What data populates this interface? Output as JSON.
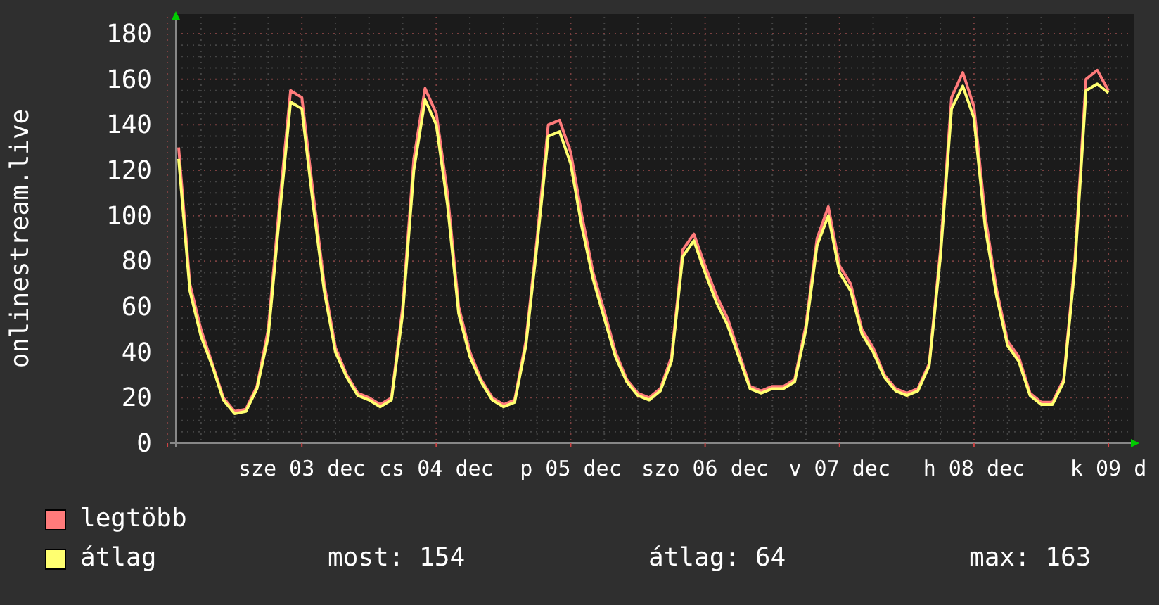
{
  "chart_data": {
    "type": "line",
    "ylabel": "onlinestream.live",
    "categories": [
      null,
      null,
      null,
      null,
      null,
      null,
      null,
      null,
      null,
      null,
      null,
      "sze 03 dec",
      null,
      null,
      null,
      null,
      null,
      null,
      null,
      null,
      null,
      null,
      null,
      "cs 04 dec",
      null,
      null,
      null,
      null,
      null,
      null,
      null,
      null,
      null,
      null,
      null,
      "p 05 dec",
      null,
      null,
      null,
      null,
      null,
      null,
      null,
      null,
      null,
      null,
      null,
      "szo 06 dec",
      null,
      null,
      null,
      null,
      null,
      null,
      null,
      null,
      null,
      null,
      null,
      "v 07 dec",
      null,
      null,
      null,
      null,
      null,
      null,
      null,
      null,
      null,
      null,
      null,
      "h 08 dec",
      null,
      null,
      null,
      null,
      null,
      null,
      null,
      null,
      null,
      null,
      null,
      "k 09 d"
    ],
    "series": [
      {
        "name": "legtöbb",
        "color": "#ff7b7b",
        "values": [
          130,
          70,
          50,
          35,
          20,
          14,
          15,
          25,
          50,
          105,
          155,
          152,
          110,
          70,
          42,
          30,
          22,
          20,
          17,
          20,
          60,
          125,
          156,
          145,
          110,
          60,
          40,
          28,
          20,
          17,
          19,
          45,
          90,
          140,
          142,
          128,
          100,
          75,
          58,
          40,
          28,
          22,
          20,
          24,
          38,
          85,
          92,
          78,
          65,
          55,
          40,
          25,
          23,
          25,
          25,
          28,
          52,
          90,
          104,
          78,
          70,
          50,
          42,
          30,
          24,
          22,
          24,
          35,
          85,
          152,
          163,
          148,
          100,
          68,
          45,
          38,
          22,
          18,
          18,
          28,
          80,
          160,
          164,
          155
        ]
      },
      {
        "name": "átlag",
        "color": "#ffff70",
        "values": [
          125,
          67,
          47,
          34,
          19,
          13,
          14,
          24,
          47,
          100,
          150,
          147,
          105,
          67,
          40,
          29,
          21,
          19,
          16,
          19,
          57,
          120,
          151,
          140,
          105,
          57,
          38,
          27,
          19,
          16,
          18,
          43,
          87,
          135,
          137,
          123,
          95,
          72,
          55,
          38,
          27,
          21,
          19,
          23,
          36,
          82,
          89,
          75,
          62,
          52,
          38,
          24,
          22,
          24,
          24,
          27,
          50,
          87,
          100,
          75,
          67,
          48,
          40,
          29,
          23,
          21,
          23,
          34,
          82,
          147,
          157,
          143,
          95,
          65,
          43,
          36,
          21,
          17,
          17,
          27,
          77,
          155,
          158,
          154
        ]
      }
    ],
    "ylim": [
      0,
      180
    ],
    "grid": true,
    "yticks": [
      0,
      20,
      40,
      60,
      80,
      100,
      120,
      140,
      160,
      180
    ]
  },
  "legend": {
    "stats": [
      {
        "label": "most: 154"
      },
      {
        "label": "átlag: 64"
      },
      {
        "label": "max: 163"
      }
    ]
  }
}
